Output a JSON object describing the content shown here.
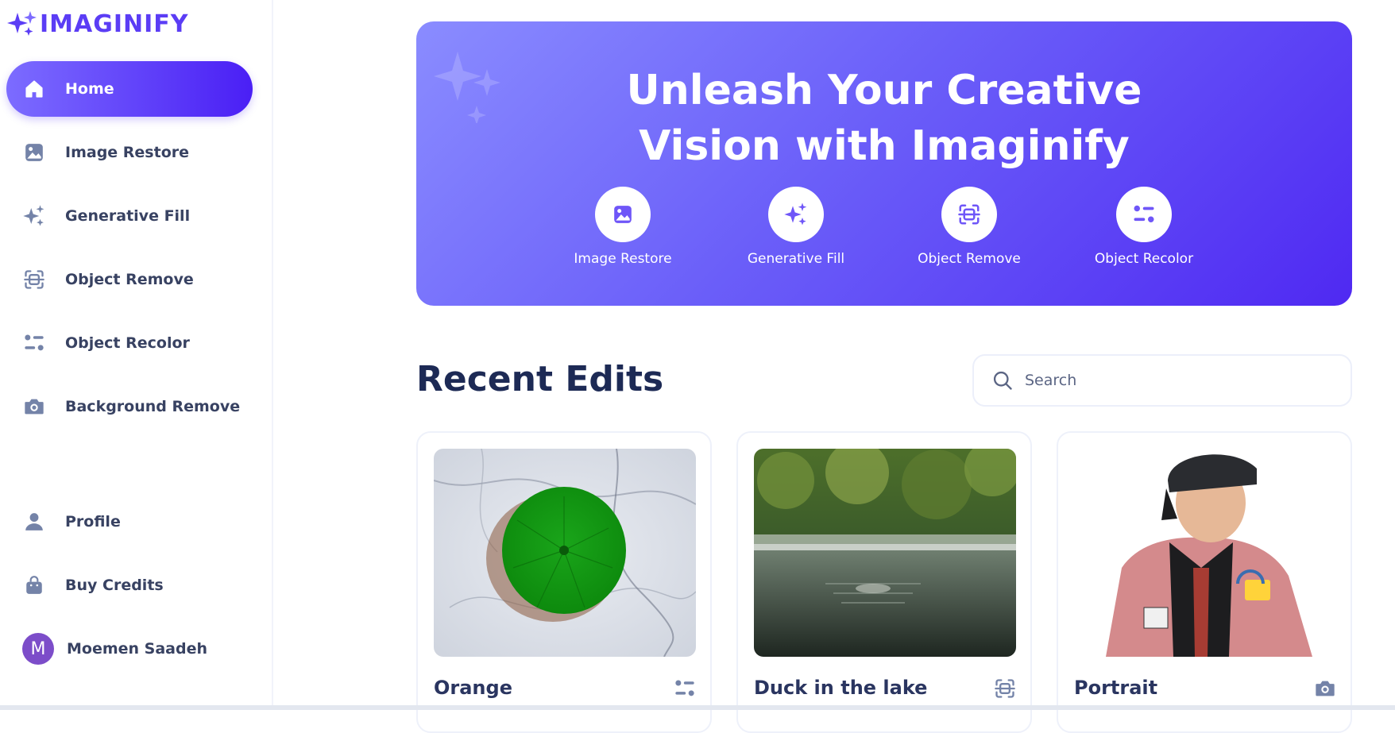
{
  "app": {
    "name": "IMAGINIFY",
    "brand_color": "#5b3df5"
  },
  "sidebar": {
    "items": [
      {
        "label": "Home",
        "icon": "home-icon",
        "active": true
      },
      {
        "label": "Image Restore",
        "icon": "image-icon"
      },
      {
        "label": "Generative Fill",
        "icon": "sparkles-icon"
      },
      {
        "label": "Object Remove",
        "icon": "scan-icon"
      },
      {
        "label": "Object Recolor",
        "icon": "filter-icon"
      },
      {
        "label": "Background Remove",
        "icon": "camera-icon"
      }
    ],
    "bottom": [
      {
        "label": "Profile",
        "icon": "user-icon"
      },
      {
        "label": "Buy Credits",
        "icon": "bag-icon"
      }
    ],
    "user": {
      "initial": "M",
      "name": "Moemen Saadeh"
    }
  },
  "hero": {
    "title_line1": "Unleash Your Creative",
    "title_line2": "Vision with Imaginify",
    "actions": [
      {
        "label": "Image Restore",
        "icon": "image-icon"
      },
      {
        "label": "Generative Fill",
        "icon": "sparkles-icon"
      },
      {
        "label": "Object Remove",
        "icon": "scan-icon"
      },
      {
        "label": "Object Recolor",
        "icon": "filter-icon"
      }
    ]
  },
  "recent": {
    "title": "Recent Edits",
    "search_placeholder": "Search",
    "cards": [
      {
        "title": "Orange",
        "icon": "filter-icon"
      },
      {
        "title": "Duck in the lake",
        "icon": "scan-icon"
      },
      {
        "title": "Portrait",
        "icon": "camera-icon"
      }
    ]
  }
}
